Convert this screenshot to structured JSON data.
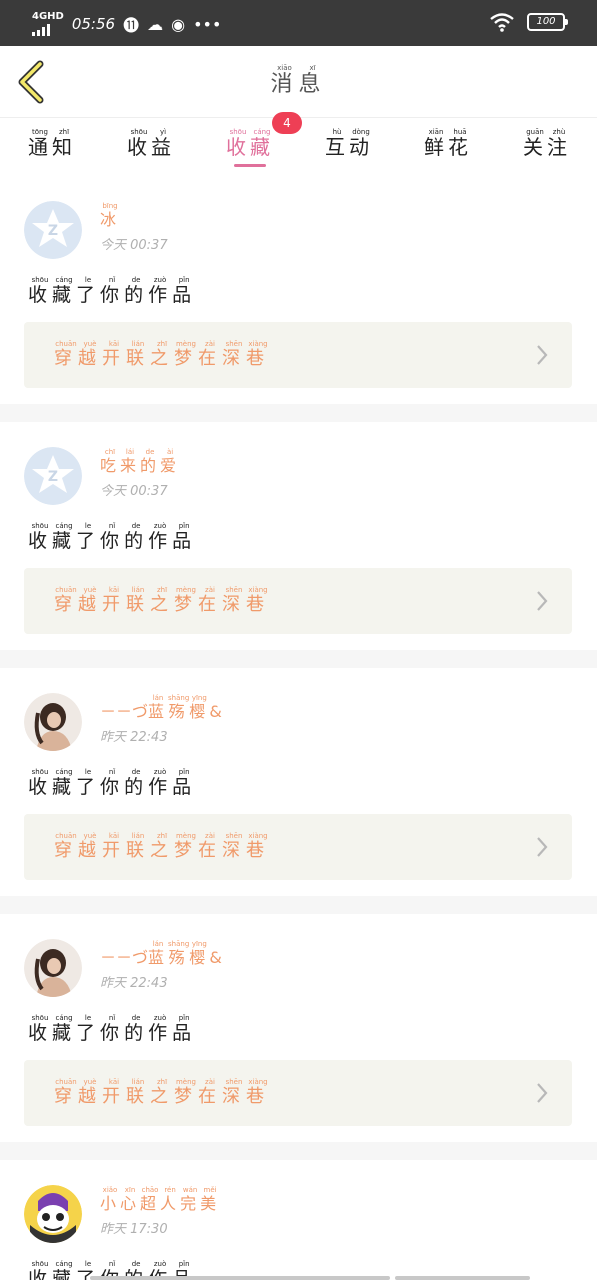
{
  "status_bar": {
    "network": "4GHD",
    "time": "05:56",
    "battery": "100"
  },
  "header": {
    "title_chars": [
      "消",
      "息"
    ],
    "title_pinyin": [
      "xiāo",
      "xī"
    ]
  },
  "tabs": [
    {
      "chars": [
        "通",
        "知"
      ],
      "pinyin": [
        "tōng",
        "zhī"
      ]
    },
    {
      "chars": [
        "收",
        "益"
      ],
      "pinyin": [
        "shōu",
        "yì"
      ]
    },
    {
      "chars": [
        "收",
        "藏"
      ],
      "pinyin": [
        "shōu",
        "cáng"
      ],
      "active": true,
      "badge": "4"
    },
    {
      "chars": [
        "互",
        "动"
      ],
      "pinyin": [
        "hù",
        "dòng"
      ]
    },
    {
      "chars": [
        "鲜",
        "花"
      ],
      "pinyin": [
        "xiān",
        "huā"
      ]
    },
    {
      "chars": [
        "关",
        "注"
      ],
      "pinyin": [
        "guān",
        "zhù"
      ]
    }
  ],
  "messages": [
    {
      "name_chars": [
        "冰"
      ],
      "name_pinyin": [
        "bīng"
      ],
      "time": "今天 00:37",
      "action_chars": [
        "收",
        "藏",
        "了",
        "你",
        "的",
        "作",
        "品"
      ],
      "action_pinyin": [
        "shōu",
        "cáng",
        "le",
        "nǐ",
        "de",
        "zuò",
        "pǐn"
      ],
      "work_chars": [
        "穿",
        "越",
        "开",
        "联",
        "之",
        "梦",
        "在",
        "深",
        "巷"
      ],
      "work_pinyin": [
        "chuān",
        "yuè",
        "kāi",
        "lián",
        "zhī",
        "mèng",
        "zài",
        "shēn",
        "xiàng"
      ],
      "avatar": "qq-default-icon"
    },
    {
      "name_chars": [
        "吃",
        "来",
        "的",
        "爱"
      ],
      "name_pinyin": [
        "chī",
        "lái",
        "de",
        "ài"
      ],
      "time": "今天 00:37",
      "action_chars": [
        "收",
        "藏",
        "了",
        "你",
        "的",
        "作",
        "品"
      ],
      "action_pinyin": [
        "shōu",
        "cáng",
        "le",
        "nǐ",
        "de",
        "zuò",
        "pǐn"
      ],
      "work_chars": [
        "穿",
        "越",
        "开",
        "联",
        "之",
        "梦",
        "在",
        "深",
        "巷"
      ],
      "work_pinyin": [
        "chuān",
        "yuè",
        "kāi",
        "lián",
        "zhī",
        "mèng",
        "zài",
        "shēn",
        "xiàng"
      ],
      "avatar": "qq-default-icon"
    },
    {
      "name_prefix": "－－づ",
      "name_chars": [
        "蓝",
        "殇",
        "樱"
      ],
      "name_pinyin": [
        "lán",
        "shāng",
        "yīng"
      ],
      "name_suffix": "&",
      "time": "昨天 22:43",
      "action_chars": [
        "收",
        "藏",
        "了",
        "你",
        "的",
        "作",
        "品"
      ],
      "action_pinyin": [
        "shōu",
        "cáng",
        "le",
        "nǐ",
        "de",
        "zuò",
        "pǐn"
      ],
      "work_chars": [
        "穿",
        "越",
        "开",
        "联",
        "之",
        "梦",
        "在",
        "深",
        "巷"
      ],
      "work_pinyin": [
        "chuān",
        "yuè",
        "kāi",
        "lián",
        "zhī",
        "mèng",
        "zài",
        "shēn",
        "xiàng"
      ],
      "avatar": "photo-avatar"
    },
    {
      "name_prefix": "－－づ",
      "name_chars": [
        "蓝",
        "殇",
        "樱"
      ],
      "name_pinyin": [
        "lán",
        "shāng",
        "yīng"
      ],
      "name_suffix": "&",
      "time": "昨天 22:43",
      "action_chars": [
        "收",
        "藏",
        "了",
        "你",
        "的",
        "作",
        "品"
      ],
      "action_pinyin": [
        "shōu",
        "cáng",
        "le",
        "nǐ",
        "de",
        "zuò",
        "pǐn"
      ],
      "work_chars": [
        "穿",
        "越",
        "开",
        "联",
        "之",
        "梦",
        "在",
        "深",
        "巷"
      ],
      "work_pinyin": [
        "chuān",
        "yuè",
        "kāi",
        "lián",
        "zhī",
        "mèng",
        "zài",
        "shēn",
        "xiàng"
      ],
      "avatar": "photo-avatar"
    },
    {
      "name_chars": [
        "小",
        "心",
        "超",
        "人",
        "完",
        "美"
      ],
      "name_pinyin": [
        "xiǎo",
        "xīn",
        "chāo",
        "rén",
        "wán",
        "měi"
      ],
      "time": "昨天 17:30",
      "action_chars": [
        "收",
        "藏",
        "了",
        "你",
        "的",
        "作",
        "品"
      ],
      "action_pinyin": [
        "shōu",
        "cáng",
        "le",
        "nǐ",
        "de",
        "zuò",
        "pǐn"
      ],
      "work_chars": [],
      "work_pinyin": [],
      "avatar": "cartoon-avatar"
    }
  ],
  "colors": {
    "accent": "#e0709b",
    "name": "#f09a6a",
    "badge": "#ee3f55",
    "work_bg": "#f4f4ee"
  }
}
